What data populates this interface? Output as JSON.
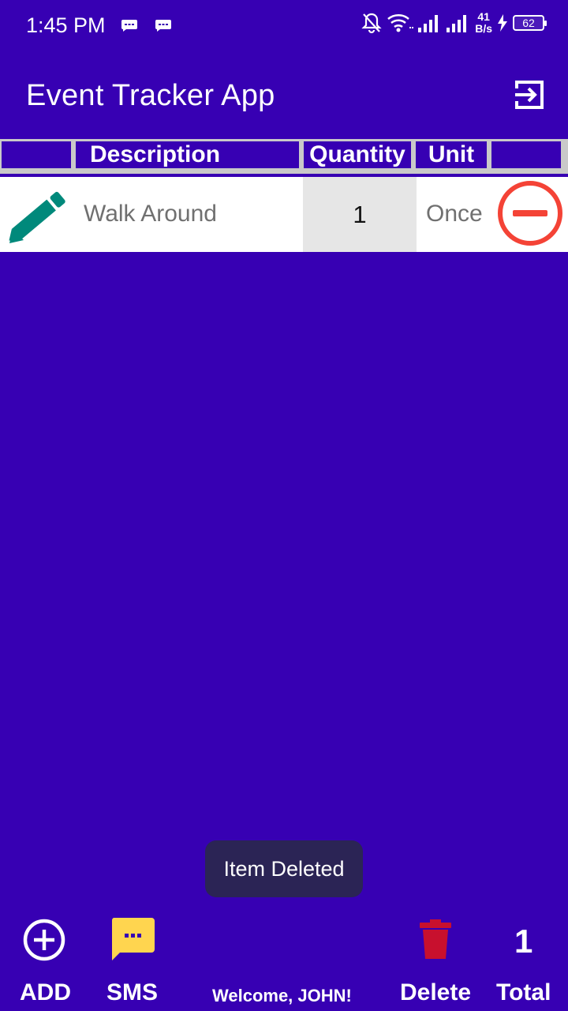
{
  "status_bar": {
    "time": "1:45 PM",
    "net_speed_value": "41",
    "net_speed_unit": "B/s",
    "battery": "62"
  },
  "app_bar": {
    "title": "Event Tracker App"
  },
  "table": {
    "headers": [
      "",
      "Description",
      "Quantity",
      "Unit",
      ""
    ],
    "rows": [
      {
        "description": "Walk Around",
        "quantity": "1",
        "unit": "Once"
      }
    ]
  },
  "toast": {
    "message": "Item Deleted"
  },
  "bottom_bar": {
    "add_label": "ADD",
    "sms_label": "SMS",
    "welcome": "Welcome, JOHN!",
    "delete_label": "Delete",
    "total_label": "Total",
    "total_value": "1"
  },
  "colors": {
    "background": "#3700B3",
    "edit_icon": "#00897B",
    "remove_icon": "#F44336",
    "sms_icon": "#FFD54F",
    "delete_icon": "#C8102E"
  }
}
